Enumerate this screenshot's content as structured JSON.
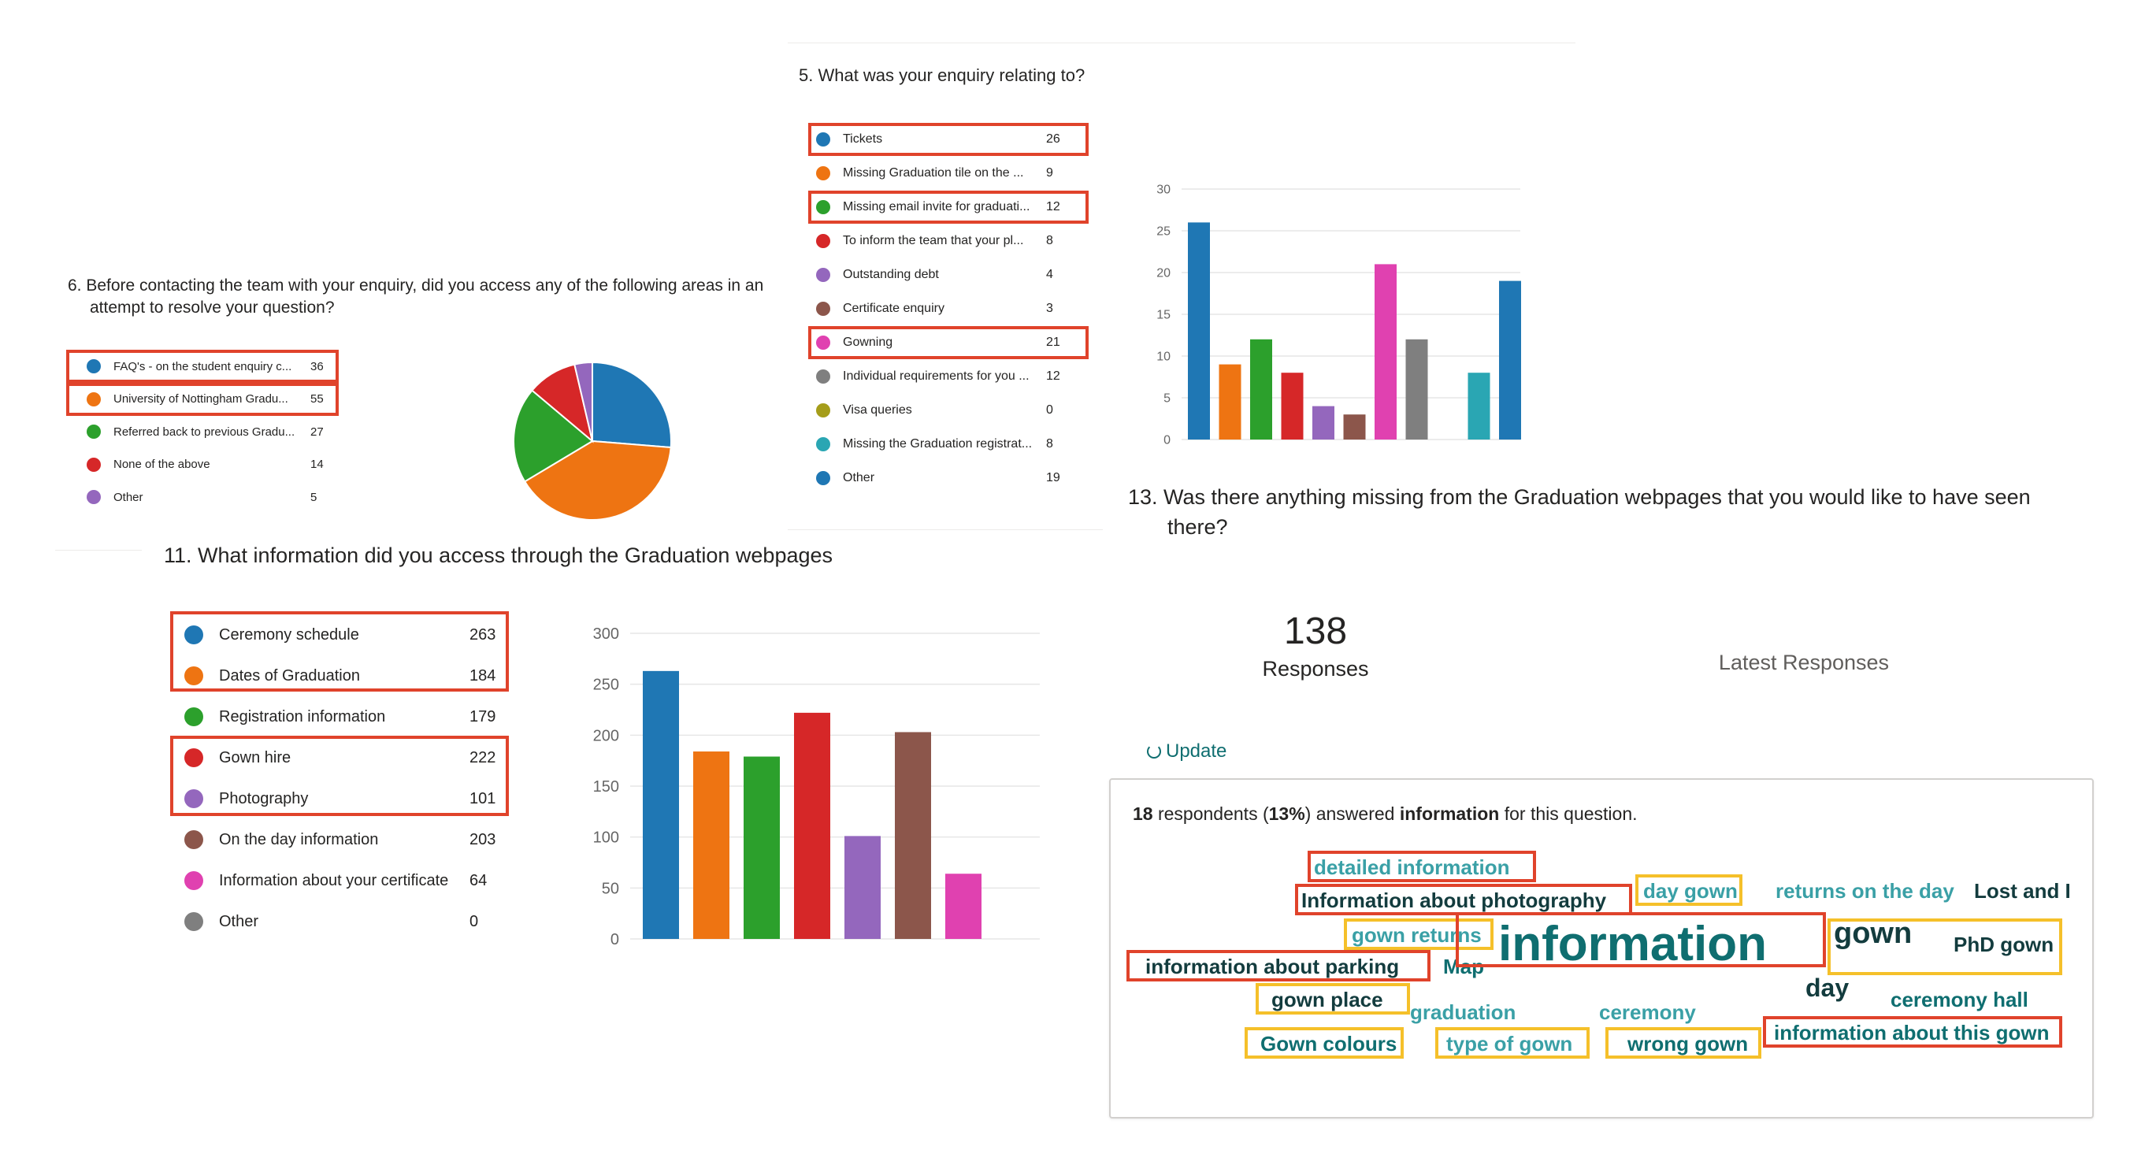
{
  "q5": {
    "question": "5.  What was your enquiry relating to?",
    "legend": [
      {
        "label": "Tickets",
        "count": "26",
        "color": "#1f77b4"
      },
      {
        "label": "Missing Graduation tile on the ...",
        "count": "9",
        "color": "#ee7412"
      },
      {
        "label": "Missing email invite for graduati...",
        "count": "12",
        "color": "#2ca02c"
      },
      {
        "label": "To inform the team that your pl...",
        "count": "8",
        "color": "#d62728"
      },
      {
        "label": "Outstanding debt",
        "count": "4",
        "color": "#9467bd"
      },
      {
        "label": "Certificate enquiry",
        "count": "3",
        "color": "#8c564b"
      },
      {
        "label": "Gowning",
        "count": "21",
        "color": "#e041b0"
      },
      {
        "label": "Individual requirements for you ...",
        "count": "12",
        "color": "#7f7f7f"
      },
      {
        "label": "Visa queries",
        "count": "0",
        "color": "#a59d1a"
      },
      {
        "label": "Missing the Graduation registrat...",
        "count": "8",
        "color": "#2aa6b3"
      },
      {
        "label": "Other",
        "count": "19",
        "color": "#1f77b4"
      }
    ]
  },
  "q6": {
    "question_line1": "6.  Before contacting the team with your enquiry, did you access any of the following areas in an",
    "question_line2": "attempt to resolve your question?",
    "legend": [
      {
        "label": "FAQ's - on the student enquiry c...",
        "count": "36",
        "color": "#1f77b4"
      },
      {
        "label": "University of Nottingham Gradu...",
        "count": "55",
        "color": "#ee7412"
      },
      {
        "label": "Referred back to previous Gradu...",
        "count": "27",
        "color": "#2ca02c"
      },
      {
        "label": "None of the above",
        "count": "14",
        "color": "#d62728"
      },
      {
        "label": "Other",
        "count": "5",
        "color": "#9467bd"
      }
    ]
  },
  "q11": {
    "question": "11.  What information did you access through the Graduation webpages",
    "legend": [
      {
        "label": "Ceremony schedule",
        "count": "263",
        "color": "#1f77b4"
      },
      {
        "label": "Dates of Graduation",
        "count": "184",
        "color": "#ee7412"
      },
      {
        "label": "Registration information",
        "count": "179",
        "color": "#2ca02c"
      },
      {
        "label": "Gown hire",
        "count": "222",
        "color": "#d62728"
      },
      {
        "label": "Photography",
        "count": "101",
        "color": "#9467bd"
      },
      {
        "label": "On the day information",
        "count": "203",
        "color": "#8c564b"
      },
      {
        "label": "Information about your certificate",
        "count": "64",
        "color": "#e041b0"
      },
      {
        "label": "Other",
        "count": "0",
        "color": "#7f7f7f"
      }
    ]
  },
  "q13": {
    "question_line1": "13.  Was there anything missing from the Graduation webpages that you would like to have seen",
    "question_line2": "there?",
    "responses_count": "138",
    "responses_label": "Responses",
    "latest_label": "Latest Responses",
    "update_label": "Update",
    "summary": {
      "count": "18",
      "mid1": " respondents (",
      "pct": "13%",
      "mid2": ") answered ",
      "keyword": "information",
      "tail": " for this question."
    },
    "cloud": [
      {
        "text": "detailed information",
        "color": "#3aa0a6"
      },
      {
        "text": "Information about photography",
        "color": "#133c3e"
      },
      {
        "text": "day gown",
        "color": "#3aa0a6"
      },
      {
        "text": "returns on the day",
        "color": "#3aa0a6"
      },
      {
        "text": "Lost and I",
        "color": "#133c3e"
      },
      {
        "text": "gown returns",
        "color": "#3aa0a6"
      },
      {
        "text": "information",
        "color": "#0f6e70"
      },
      {
        "text": "gown",
        "color": "#133c3e"
      },
      {
        "text": "PhD gown",
        "color": "#133c3e"
      },
      {
        "text": "information about parking",
        "color": "#133c3e"
      },
      {
        "text": "Map",
        "color": "#0f6e70"
      },
      {
        "text": "day",
        "color": "#133c3e"
      },
      {
        "text": "gown place",
        "color": "#133c3e"
      },
      {
        "text": "ceremony hall",
        "color": "#0f6e70"
      },
      {
        "text": "graduation",
        "color": "#3aa0a6"
      },
      {
        "text": "ceremony",
        "color": "#3aa0a6"
      },
      {
        "text": "information about this gown",
        "color": "#0f6e70"
      },
      {
        "text": "Gown colours",
        "color": "#0f6e70"
      },
      {
        "text": "type of gown",
        "color": "#3aa0a6"
      },
      {
        "text": "wrong gown",
        "color": "#0f6e70"
      }
    ]
  },
  "chart_data": [
    {
      "type": "bar",
      "categories": [
        "Tickets",
        "Missing Graduation tile on the ...",
        "Missing email invite for graduati...",
        "To inform the team that your pl...",
        "Outstanding debt",
        "Certificate enquiry",
        "Gowning",
        "Individual requirements for you ...",
        "Visa queries",
        "Missing the Graduation registrat...",
        "Other"
      ],
      "values": [
        26,
        9,
        12,
        8,
        4,
        3,
        21,
        12,
        0,
        8,
        19
      ],
      "colors": [
        "#1f77b4",
        "#ee7412",
        "#2ca02c",
        "#d62728",
        "#9467bd",
        "#8c564b",
        "#e041b0",
        "#7f7f7f",
        "#a59d1a",
        "#2aa6b3",
        "#1f77b4"
      ],
      "yticks": [
        0,
        5,
        10,
        15,
        20,
        25,
        30
      ],
      "ylim": [
        0,
        30
      ],
      "grid": true
    },
    {
      "type": "pie",
      "categories": [
        "FAQ's - on the student enquiry c...",
        "University of Nottingham Gradu...",
        "Referred back to previous Gradu...",
        "None of the above",
        "Other"
      ],
      "values": [
        36,
        55,
        27,
        14,
        5
      ],
      "colors": [
        "#1f77b4",
        "#ee7412",
        "#2ca02c",
        "#d62728",
        "#9467bd"
      ]
    },
    {
      "type": "bar",
      "categories": [
        "Ceremony schedule",
        "Dates of Graduation",
        "Registration information",
        "Gown hire",
        "Photography",
        "On the day information",
        "Information about your certificate",
        "Other"
      ],
      "values": [
        263,
        184,
        179,
        222,
        101,
        203,
        64,
        0
      ],
      "colors": [
        "#1f77b4",
        "#ee7412",
        "#2ca02c",
        "#d62728",
        "#9467bd",
        "#8c564b",
        "#e041b0",
        "#7f7f7f"
      ],
      "yticks": [
        0,
        50,
        100,
        150,
        200,
        250,
        300
      ],
      "ylim": [
        0,
        300
      ],
      "grid": true
    }
  ]
}
